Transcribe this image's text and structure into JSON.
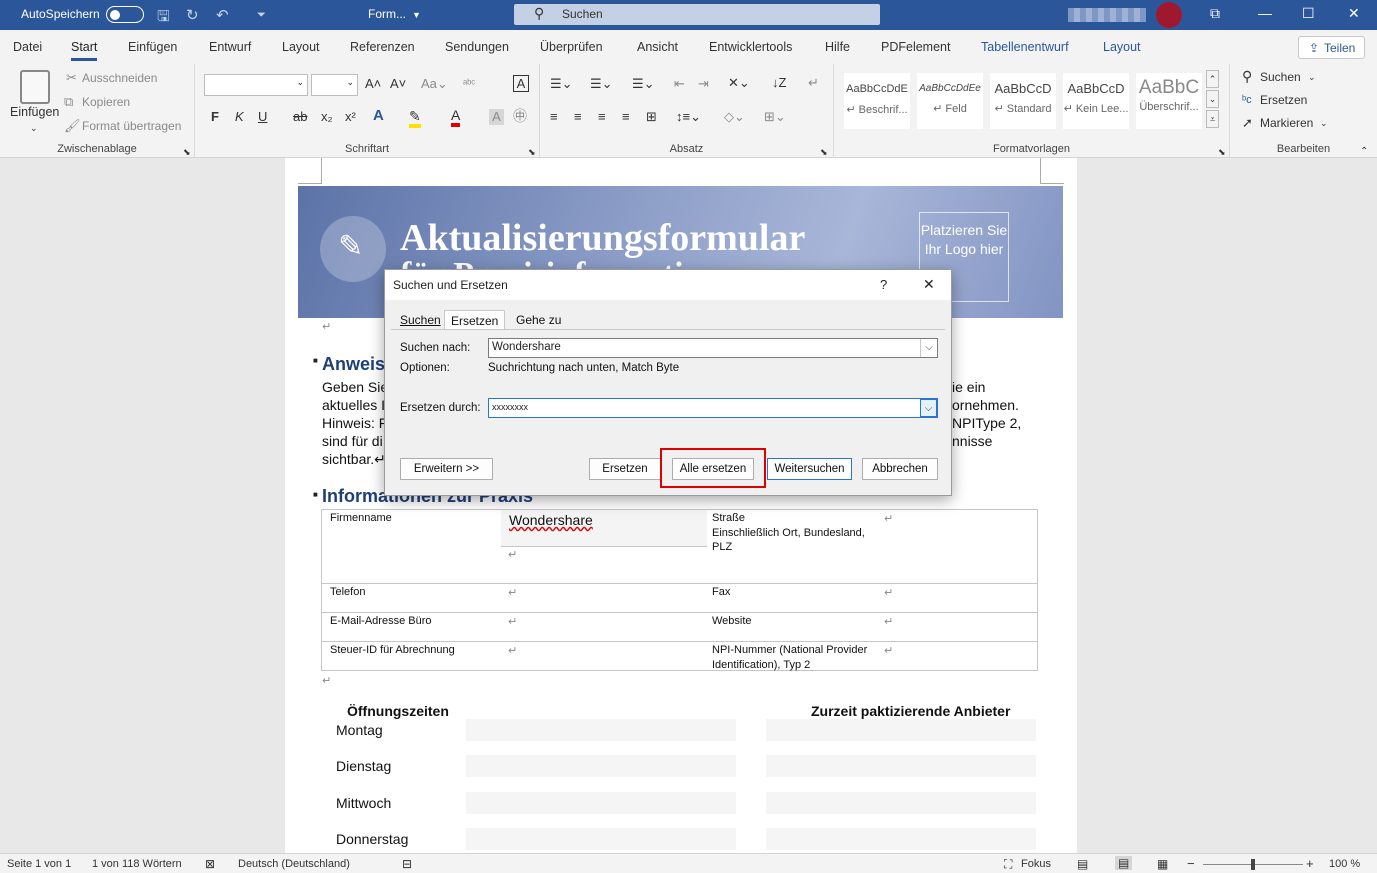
{
  "titlebar": {
    "autosave": "AutoSpeichern",
    "doc_name": "Form...",
    "search": "Suchen"
  },
  "tabs": [
    "Datei",
    "Start",
    "Einfügen",
    "Entwurf",
    "Layout",
    "Referenzen",
    "Sendungen",
    "Überprüfen",
    "Ansicht",
    "Entwicklertools",
    "Hilfe",
    "PDFelement",
    "Tabellenentwurf",
    "Layout"
  ],
  "share": "Teilen",
  "clipboard": {
    "paste": "Einfügen",
    "cut": "Ausschneiden",
    "copy": "Kopieren",
    "format_painter": "Format übertragen",
    "label": "Zwischenablage"
  },
  "font": {
    "label": "Schriftart",
    "bold": "F",
    "italic": "K",
    "underline": "U",
    "strike": "ab",
    "sub": "x₂",
    "sup": "x²"
  },
  "paragraph": {
    "label": "Absatz"
  },
  "styles": {
    "label": "Formatvorlagen",
    "items": [
      {
        "preview": "AaBbCcDdE",
        "name": "↵ Beschrif..."
      },
      {
        "preview": "AaBbCcDdEe",
        "name": "↵ Feld"
      },
      {
        "preview": "AaBbCcD",
        "name": "↵ Standard"
      },
      {
        "preview": "AaBbCcD",
        "name": "↵ Kein Lee..."
      },
      {
        "preview": "AaBbC",
        "name": "Überschrif..."
      }
    ]
  },
  "editing": {
    "label": "Bearbeiten",
    "find": "Suchen",
    "replace": "Ersetzen",
    "select": "Markieren"
  },
  "document": {
    "banner_title": "Aktualisierungsformular",
    "banner_sub": "für Praxisinformationen",
    "logo_placeholder": "Platzieren Sie Ihr Logo hier",
    "h_instructions": "Anweis",
    "body_left": [
      "Geben Sie",
      "aktuelles I",
      "Hinweis: F",
      "sind für di",
      "sichtbar.↵"
    ],
    "body_right": [
      "ie ein",
      "ornehmen.",
      "NPIType 2,",
      "nnisse"
    ],
    "h_info": "Informationen zur Praxis",
    "rows": [
      {
        "l1": "Firmenname",
        "v1": "Wondershare",
        "l2": "Straße",
        "l2b": "Einschließlich Ort, Bundesland,",
        "l2c": "PLZ"
      },
      {
        "l1": "Telefon",
        "l2": "Fax"
      },
      {
        "l1": "E-Mail-Adresse Büro",
        "l2": "Website"
      },
      {
        "l1": "Steuer-ID für Abrechnung",
        "l2": "NPI-Nummer (National Provider",
        "l2b": "Identification), Typ 2"
      }
    ],
    "hours_head": "Öffnungszeiten",
    "providers_head": "Zurzeit paktizierende Anbieter",
    "days": [
      "Montag",
      "Dienstag",
      "Mittwoch",
      "Donnerstag"
    ]
  },
  "dialog": {
    "title": "Suchen und Ersetzen",
    "help": "?",
    "close": "✕",
    "tabs": [
      "Suchen",
      "Ersetzen",
      "Gehe zu"
    ],
    "find_label": "Suchen nach:",
    "find_value": "Wondershare",
    "options_label": "Optionen:",
    "options_value": "Suchrichtung nach unten, Match Byte",
    "replace_label": "Ersetzen durch:",
    "replace_value": "xxxxxxxx",
    "btn_more": "Erweitern >>",
    "btn_replace": "Ersetzen",
    "btn_replace_all": "Alle ersetzen",
    "btn_find_next": "Weitersuchen",
    "btn_cancel": "Abbrechen"
  },
  "status": {
    "page": "Seite 1 von 1",
    "words": "1 von 118 Wörtern",
    "language": "Deutsch (Deutschland)",
    "focus": "Fokus",
    "zoom": "100 %"
  }
}
